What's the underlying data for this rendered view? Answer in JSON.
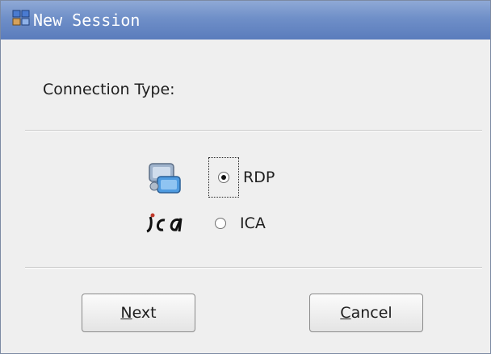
{
  "window": {
    "title": "New Session",
    "icon": "network-session-icon"
  },
  "content": {
    "connection_type_label": "Connection Type:"
  },
  "options": [
    {
      "label": "RDP",
      "checked": true,
      "icon": "rdp-computer-icon"
    },
    {
      "label": "ICA",
      "checked": false,
      "icon": "ica-logo-icon"
    }
  ],
  "buttons": {
    "next": {
      "mnemonic": "N",
      "rest": "ext"
    },
    "cancel": {
      "mnemonic": "C",
      "rest": "ancel"
    }
  },
  "colors": {
    "titlebar": "#6f8fc8",
    "background": "#efefef"
  }
}
